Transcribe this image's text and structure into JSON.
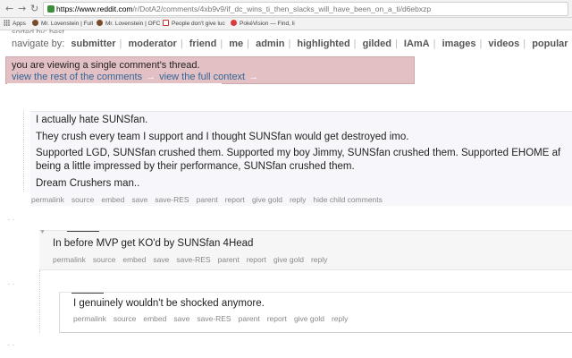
{
  "browser": {
    "url_host": "https://www.reddit.com",
    "url_path": "/r/DotA2/comments/4xb9v9/if_dc_wins_ti_then_slacks_will_have_been_on_a_ti/d6ebxzp",
    "bookmarks": [
      {
        "label": "Apps",
        "icon": "apps-grid-icon",
        "color": "#555555"
      },
      {
        "label": "Mr. Lovenstein | Full",
        "icon": "lovenstein-icon",
        "color": "#7a4a2a"
      },
      {
        "label": "Mr. Lovenstein | OFC",
        "icon": "lovenstein-icon",
        "color": "#7a4a2a"
      },
      {
        "label": "People don't give luc",
        "icon": "page-icon",
        "color": "#cc3333"
      },
      {
        "label": "PokéVision — Find, li",
        "icon": "pokevision-icon",
        "color": "#d93a3a"
      }
    ]
  },
  "page": {
    "sorted_by": "sorted by: best",
    "nav_label": "navigate by:",
    "nav_items": [
      "submitter",
      "moderator",
      "friend",
      "me",
      "admin",
      "highlighted",
      "gilded",
      "IAmA",
      "images",
      "videos",
      "popular",
      "new"
    ],
    "notice": {
      "text": "you are viewing a single comment's thread.",
      "link_rest": "view the rest of the comments",
      "link_context": "view the full context",
      "arrow": "→"
    }
  },
  "comments": [
    {
      "lines": [
        "I actually hate SUNSfan.",
        "They crush every team I support and I thought SUNSfan would get destroyed imo.",
        "Supported LGD, SUNSfan crushed them. Supported my boy Jimmy, SUNSfan crushed them. Supported EHOME af",
        "being a little impressed by their performance, SUNSfan crushed them.",
        "Dream Crushers man.."
      ],
      "actions": [
        "permalink",
        "source",
        "embed",
        "save",
        "save-RES",
        "parent",
        "report",
        "give gold",
        "reply",
        "hide child comments"
      ]
    },
    {
      "lines": [
        "In before MVP get KO'd by SUNSfan 4Head"
      ],
      "actions": [
        "permalink",
        "source",
        "embed",
        "save",
        "save-RES",
        "parent",
        "report",
        "give gold",
        "reply"
      ]
    },
    {
      "lines": [
        "I genuinely wouldn't be shocked anymore."
      ],
      "actions": [
        "permalink",
        "source",
        "embed",
        "save",
        "save-RES",
        "parent",
        "report",
        "give gold",
        "reply"
      ]
    }
  ]
}
